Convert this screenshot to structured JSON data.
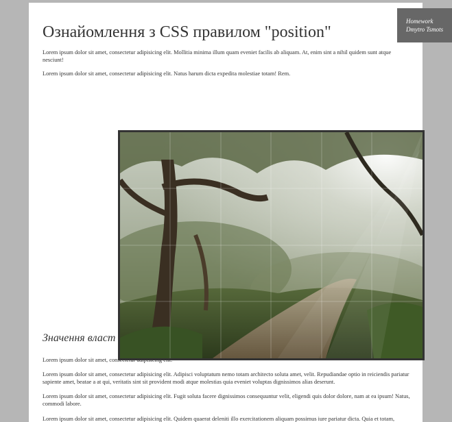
{
  "page": {
    "title": "Ознайомлення з CSS правилом \"position\"",
    "paragraphs_top": [
      "Lorem ipsum dolor sit amet, consectetur adipisicing elit. Mollitia minima illum quam eveniet facilis ab aliquam. At, enim sint a nihil quidem sunt atque nesciunt!",
      "Lorem ipsum dolor sit amet, consectetur adipisicing elit. Natus harum dicta expedita molestiae totam! Rem."
    ],
    "section_heading": "Значення власт",
    "paragraphs_bottom": [
      "Lorem ipsum dolor sit amet, consectetur adipisicing elit.",
      "Lorem ipsum dolor sit amet, consectetur adipisicing elit. Adipisci voluptatum nemo totam architecto soluta amet, velit. Repudiandae optio in reiciendis pariatur sapiente amet, beatae a at qui, veritatis sint sit provident modi atque molestias quia eveniet voluptas dignissimos alias deserunt.",
      "Lorem ipsum dolor sit amet, consectetur adipisicing elit. Fugit soluta facere dignissimos consequuntur velit, eligendi quis dolor dolore, nam at ea ipsum! Natus, commodi labore.",
      "Lorem ipsum dolor sit amet, consectetur adipisicing elit. Quidem quaerat deleniti illo exercitationem aliquam possimus iure pariatur dicta. Quia et totam,"
    ]
  },
  "badge": {
    "line1": "Homework",
    "line2": "Dmytro Tsmots"
  },
  "image": {
    "subject": "forest-path-jigsaw-puzzle"
  },
  "colors": {
    "background": "#b6b6b6",
    "page": "#ffffff",
    "text": "#333333",
    "badge": "#676767",
    "frame": "#333333"
  }
}
